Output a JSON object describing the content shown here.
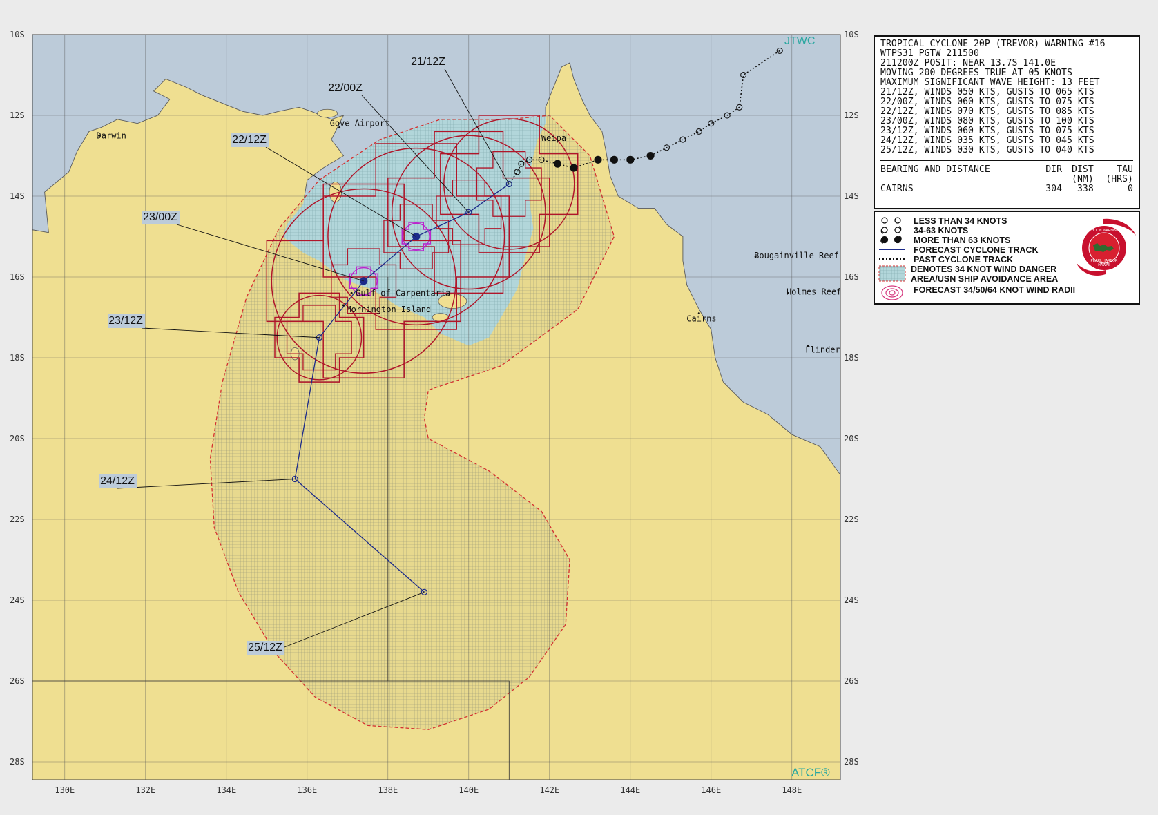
{
  "header": {
    "lines": [
      "TROPICAL CYCLONE 20P (TREVOR) WARNING #16",
      "WTPS31 PGTW 211500",
      "211200Z POSIT: NEAR 13.7S 141.0E",
      "MOVING 200 DEGREES TRUE AT 05 KNOTS",
      "MAXIMUM SIGNIFICANT WAVE HEIGHT: 13 FEET",
      "21/12Z, WINDS 050 KTS, GUSTS TO 065 KTS",
      "22/00Z, WINDS 060 KTS, GUSTS TO 075 KTS",
      "22/12Z, WINDS 070 KTS, GUSTS TO 085 KTS",
      "23/00Z, WINDS 080 KTS, GUSTS TO 100 KTS",
      "23/12Z, WINDS 060 KTS, GUSTS TO 075 KTS",
      "24/12Z, WINDS 035 KTS, GUSTS TO 045 KTS",
      "25/12Z, WINDS 030 KTS, GUSTS TO 040 KTS"
    ]
  },
  "bearing_table": {
    "title": "BEARING AND DISTANCE",
    "col_dir": "DIR",
    "col_dist": "DIST",
    "col_dist_unit": "(NM)",
    "col_tau": "TAU",
    "col_tau_unit": "(HRS)",
    "row": {
      "place": "CAIRNS",
      "dir": "304",
      "dist": "338",
      "tau": "0"
    }
  },
  "legend": {
    "items": [
      "LESS THAN 34 KNOTS",
      "34-63 KNOTS",
      "MORE THAN 63 KNOTS",
      "FORECAST CYCLONE TRACK",
      "PAST CYCLONE TRACK",
      "DENOTES 34 KNOT WIND DANGER",
      "AREA/USN SHIP AVOIDANCE AREA",
      "FORECAST 34/50/64 KNOT WIND RADII"
    ],
    "seal_text": [
      "JOINT TYPHOON WARNING CENTER",
      "PEARL HARBOR",
      "HAWAII"
    ]
  },
  "branding": {
    "jtwc": "JTWC",
    "atcf": "ATCF®"
  },
  "axes": {
    "lat_labels": [
      "10S",
      "12S",
      "14S",
      "16S",
      "18S",
      "20S",
      "22S",
      "24S",
      "26S",
      "28S"
    ],
    "lon_labels": [
      "130E",
      "132E",
      "134E",
      "136E",
      "138E",
      "140E",
      "142E",
      "144E",
      "146E",
      "148E"
    ]
  },
  "places": [
    {
      "name": "Darwin",
      "lat": 12.5,
      "lon": 130.85
    },
    {
      "name": "Gove Airport",
      "lat": 12.3,
      "lon": 136.8
    },
    {
      "name": "Weipa",
      "lat": 12.6,
      "lon": 141.9
    },
    {
      "name": "Gulf of Carpentaria",
      "lat": 16.4,
      "lon": 137.1
    },
    {
      "name": "Mornington Island",
      "lat": 16.7,
      "lon": 136.9
    },
    {
      "name": "Bougainville Reef",
      "lat": 15.5,
      "lon": 147.1
    },
    {
      "name": "Holmes Reef",
      "lat": 16.4,
      "lon": 147.9
    },
    {
      "name": "Cairns",
      "lat": 16.9,
      "lon": 145.7
    },
    {
      "name": "Flinders Reef",
      "lat": 17.7,
      "lon": 148.4
    }
  ],
  "forecast": [
    {
      "label": "21/12Z",
      "lat": 13.7,
      "lon": 141.0,
      "wind_kt": 50
    },
    {
      "label": "22/00Z",
      "lat": 14.4,
      "lon": 140.0,
      "wind_kt": 60
    },
    {
      "label": "22/12Z",
      "lat": 15.0,
      "lon": 138.7,
      "wind_kt": 70
    },
    {
      "label": "23/00Z",
      "lat": 16.1,
      "lon": 137.4,
      "wind_kt": 80
    },
    {
      "label": "23/12Z",
      "lat": 17.5,
      "lon": 136.3,
      "wind_kt": 60
    },
    {
      "label": "24/12Z",
      "lat": 21.0,
      "lon": 135.7,
      "wind_kt": 35
    },
    {
      "label": "25/12Z",
      "lat": 23.8,
      "lon": 138.9,
      "wind_kt": 30
    }
  ],
  "past_track": [
    {
      "lat": 10.4,
      "lon": 147.7
    },
    {
      "lat": 11.0,
      "lon": 146.8
    },
    {
      "lat": 11.8,
      "lon": 146.7
    },
    {
      "lat": 12.0,
      "lon": 146.4
    },
    {
      "lat": 12.2,
      "lon": 146.0
    },
    {
      "lat": 12.4,
      "lon": 145.7
    },
    {
      "lat": 12.6,
      "lon": 145.3
    },
    {
      "lat": 12.8,
      "lon": 144.9
    },
    {
      "lat": 13.0,
      "lon": 144.5
    },
    {
      "lat": 13.1,
      "lon": 144.0
    },
    {
      "lat": 13.1,
      "lon": 143.6
    },
    {
      "lat": 13.1,
      "lon": 143.2
    },
    {
      "lat": 13.3,
      "lon": 142.6
    },
    {
      "lat": 13.2,
      "lon": 142.2
    },
    {
      "lat": 13.1,
      "lon": 141.8
    },
    {
      "lat": 13.1,
      "lon": 141.5
    },
    {
      "lat": 13.2,
      "lon": 141.3
    },
    {
      "lat": 13.4,
      "lon": 141.2
    },
    {
      "lat": 13.7,
      "lon": 141.0
    }
  ],
  "colors": {
    "water": "#bccbd9",
    "land": "#efdf91",
    "coast": "#5a5a5a",
    "danger_outline": "#d43030",
    "radii": "#b0162a",
    "radii_50": "#b01a60",
    "radii_64": "#bb22cc",
    "track": "#1b2a8a",
    "hatch": "#8aa8a8"
  }
}
